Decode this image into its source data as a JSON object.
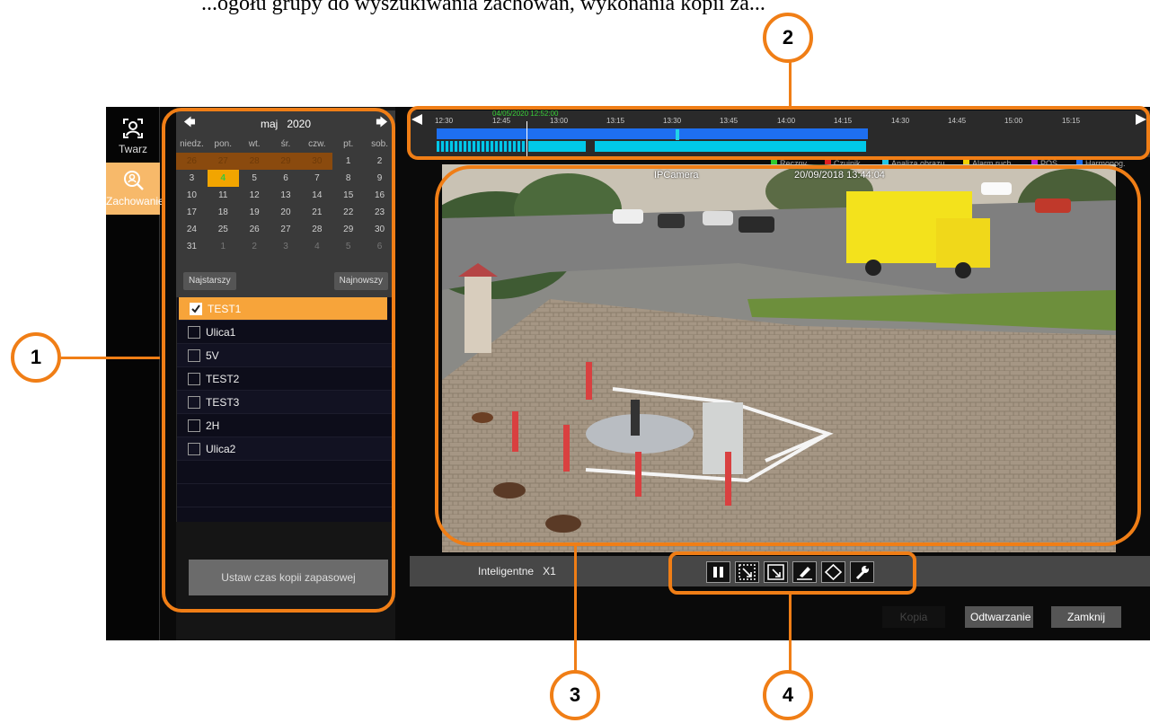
{
  "caption": "...ogółu grupy do wyszukiwania zachowań, wykonania kopii za...",
  "nav": {
    "items": [
      {
        "label": "Twarz",
        "icon": "face-icon"
      },
      {
        "label": "Zachowanie",
        "icon": "behavior-search-icon"
      }
    ]
  },
  "calendar": {
    "month": "maj",
    "year": "2020",
    "prev_icon": "arrow-left-icon",
    "next_icon": "arrow-right-icon",
    "weekdays": [
      "niedz.",
      "pon.",
      "wt.",
      "śr.",
      "czw.",
      "pt.",
      "sob."
    ],
    "weeks": [
      [
        "26",
        "27",
        "28",
        "29",
        "30",
        "1",
        "2"
      ],
      [
        "3",
        "4",
        "5",
        "6",
        "7",
        "8",
        "9"
      ],
      [
        "10",
        "11",
        "12",
        "13",
        "14",
        "15",
        "16"
      ],
      [
        "17",
        "18",
        "19",
        "20",
        "21",
        "22",
        "23"
      ],
      [
        "24",
        "25",
        "26",
        "27",
        "28",
        "29",
        "30"
      ],
      [
        "31",
        "1",
        "2",
        "3",
        "4",
        "5",
        "6"
      ]
    ],
    "oldest_label": "Najstarszy",
    "newest_label": "Najnowszy"
  },
  "channels": [
    {
      "name": "TEST1",
      "checked": true
    },
    {
      "name": "Ulica1",
      "checked": false
    },
    {
      "name": "5V",
      "checked": false
    },
    {
      "name": "TEST2",
      "checked": false
    },
    {
      "name": "TEST3",
      "checked": false
    },
    {
      "name": "2H",
      "checked": false
    },
    {
      "name": "Ulica2",
      "checked": false
    }
  ],
  "backup_button": "Ustaw czas kopii zapasowej",
  "timeline": {
    "current": "04/05/2020 12:52:00",
    "ticks": [
      "12:30",
      "12:45",
      "13:00",
      "13:15",
      "13:30",
      "13:45",
      "14:00",
      "14:15",
      "14:30",
      "14:45",
      "15:00",
      "15:15"
    ]
  },
  "legend": [
    {
      "label": "Ręczny",
      "color": "#2ecc2e"
    },
    {
      "label": "Czujnik",
      "color": "#e02020"
    },
    {
      "label": "Analiza obrazu",
      "color": "#22c6e6"
    },
    {
      "label": "Alarm ruch",
      "color": "#f0d000"
    },
    {
      "label": "POS",
      "color": "#b020e0"
    },
    {
      "label": "Harmonog.",
      "color": "#1e6ff0"
    }
  ],
  "video": {
    "camera_name": "IPCamera",
    "timestamp": "20/09/2018 13:44:04"
  },
  "playback": {
    "mode": "Inteligentne",
    "speed": "X1",
    "tools": [
      "pause-icon",
      "zoom-in-icon",
      "zoom-out-icon",
      "draw-icon",
      "area-icon",
      "settings-wrench-icon"
    ]
  },
  "buttons": {
    "copy": "Kopia",
    "play": "Odtwarzanie",
    "close": "Zamknij"
  },
  "callouts": [
    "1",
    "2",
    "3",
    "4"
  ]
}
